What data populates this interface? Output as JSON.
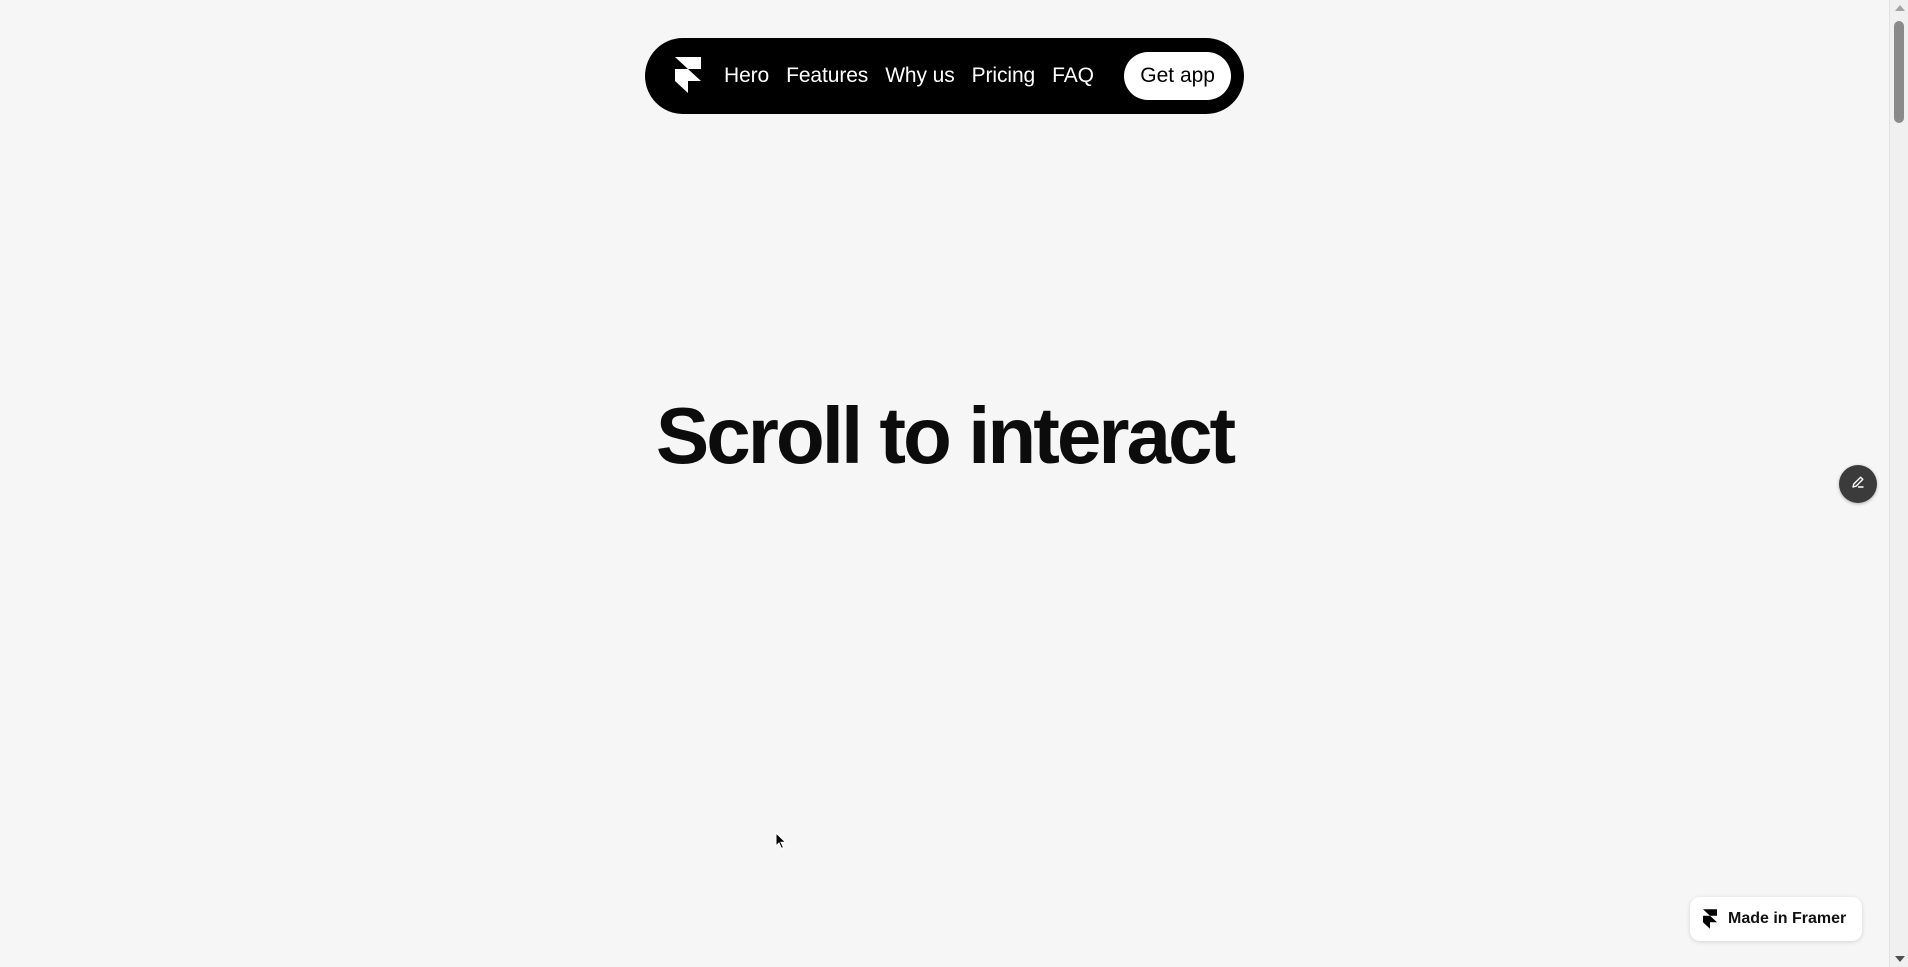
{
  "nav": {
    "logo_icon": "framer-logo-icon",
    "links": [
      {
        "label": "Hero"
      },
      {
        "label": "Features"
      },
      {
        "label": "Why us"
      },
      {
        "label": "Pricing"
      },
      {
        "label": "FAQ"
      }
    ],
    "cta_label": "Get app"
  },
  "hero": {
    "title": "Scroll to interact"
  },
  "edit_button": {
    "icon": "pencil-icon"
  },
  "badge": {
    "icon": "framer-logo-icon",
    "label": "Made in Framer"
  },
  "colors": {
    "page_background": "#f6f6f6",
    "nav_background": "#000000",
    "nav_text": "#ffffff",
    "title_text": "#0c0c0c",
    "edit_button_background": "#3b3b3b"
  }
}
